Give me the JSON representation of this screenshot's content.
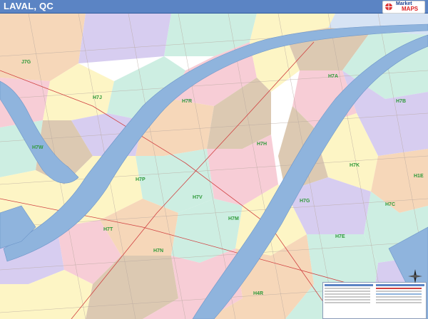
{
  "title": "LAVAL, QC",
  "logo": {
    "line1": "Market",
    "line2": "MAPS",
    "icon": "market-maps-logo"
  },
  "colors": {
    "title_bar": "#5b84c4",
    "water": "#8fb4dd",
    "zip_label": "#2f9a3a",
    "zones": [
      "#f7cdd6",
      "#d7cdf0",
      "#fdf5c5",
      "#cdeee2",
      "#f6d7b9",
      "#dcc9b2",
      "#d6e3f4"
    ]
  },
  "zip_labels": [
    "H7R",
    "H7J",
    "H7A",
    "H7W",
    "H7H",
    "H7P",
    "H7V",
    "J7G",
    "H7T",
    "H7N",
    "H7M",
    "H7K",
    "H7G",
    "H7E",
    "H7C",
    "H7B",
    "H4R",
    "H1E"
  ],
  "compass": {
    "icon": "compass-rose-icon"
  },
  "legend": {
    "icon": "map-legend"
  }
}
